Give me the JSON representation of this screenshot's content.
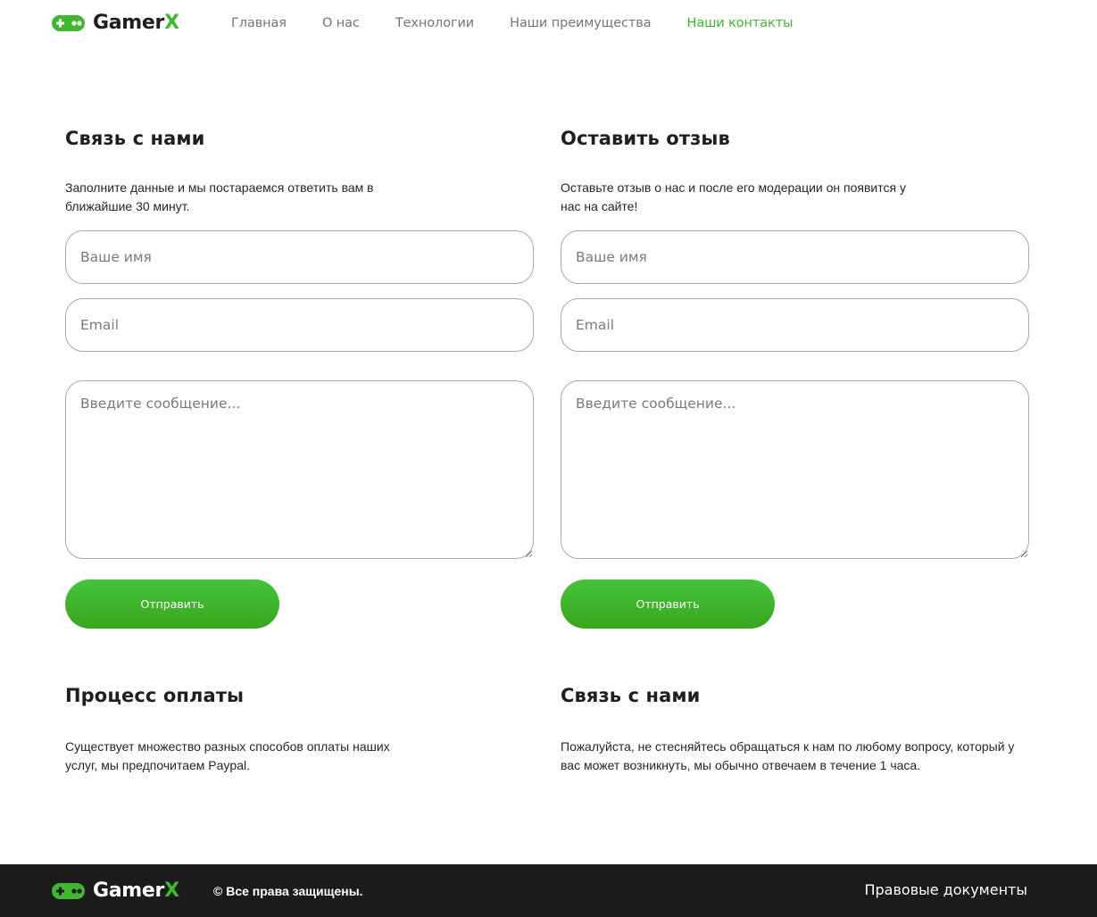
{
  "brand": {
    "name_main": "Gamer",
    "name_accent": "X"
  },
  "colors": {
    "accent": "#3fb830",
    "footer_bg": "#1b1b1b",
    "text": "#1f1f1f"
  },
  "nav": {
    "items": [
      {
        "label": "Главная"
      },
      {
        "label": "О нас"
      },
      {
        "label": "Технологии"
      },
      {
        "label": "Наши преимущества"
      },
      {
        "label": "Наши контакты",
        "active": true
      }
    ]
  },
  "contact_form": {
    "title": "Связь с нами",
    "description": "Заполните данные и мы постараемся ответить вам в ближайшие 30 минут.",
    "name_placeholder": "Ваше имя",
    "email_placeholder": "Email",
    "message_placeholder": "Введите сообщение...",
    "submit_label": "Отправить"
  },
  "review_form": {
    "title": "Оставить отзыв",
    "description": "Оставьте отзыв о нас и после его модерации он появится у нас на сайте!",
    "name_placeholder": "Ваше имя",
    "email_placeholder": "Email",
    "message_placeholder": "Введите сообщение...",
    "submit_label": "Отправить"
  },
  "payment_info": {
    "title": "Процесс оплаты",
    "description": "Существует множество разных способов оплаты наших услуг, мы предпочитаем Paypal."
  },
  "contact_info": {
    "title": "Связь с нами",
    "description": "Пожалуйста, не стесняйтесь обращаться к нам по любому вопросу, который у вас может возникнуть, мы обычно отвечаем в течение 1 часа."
  },
  "footer": {
    "copyright": "© Все права защищены.",
    "legal_link": "Правовые документы"
  },
  "icons": {
    "logo": "gamepad-icon"
  }
}
